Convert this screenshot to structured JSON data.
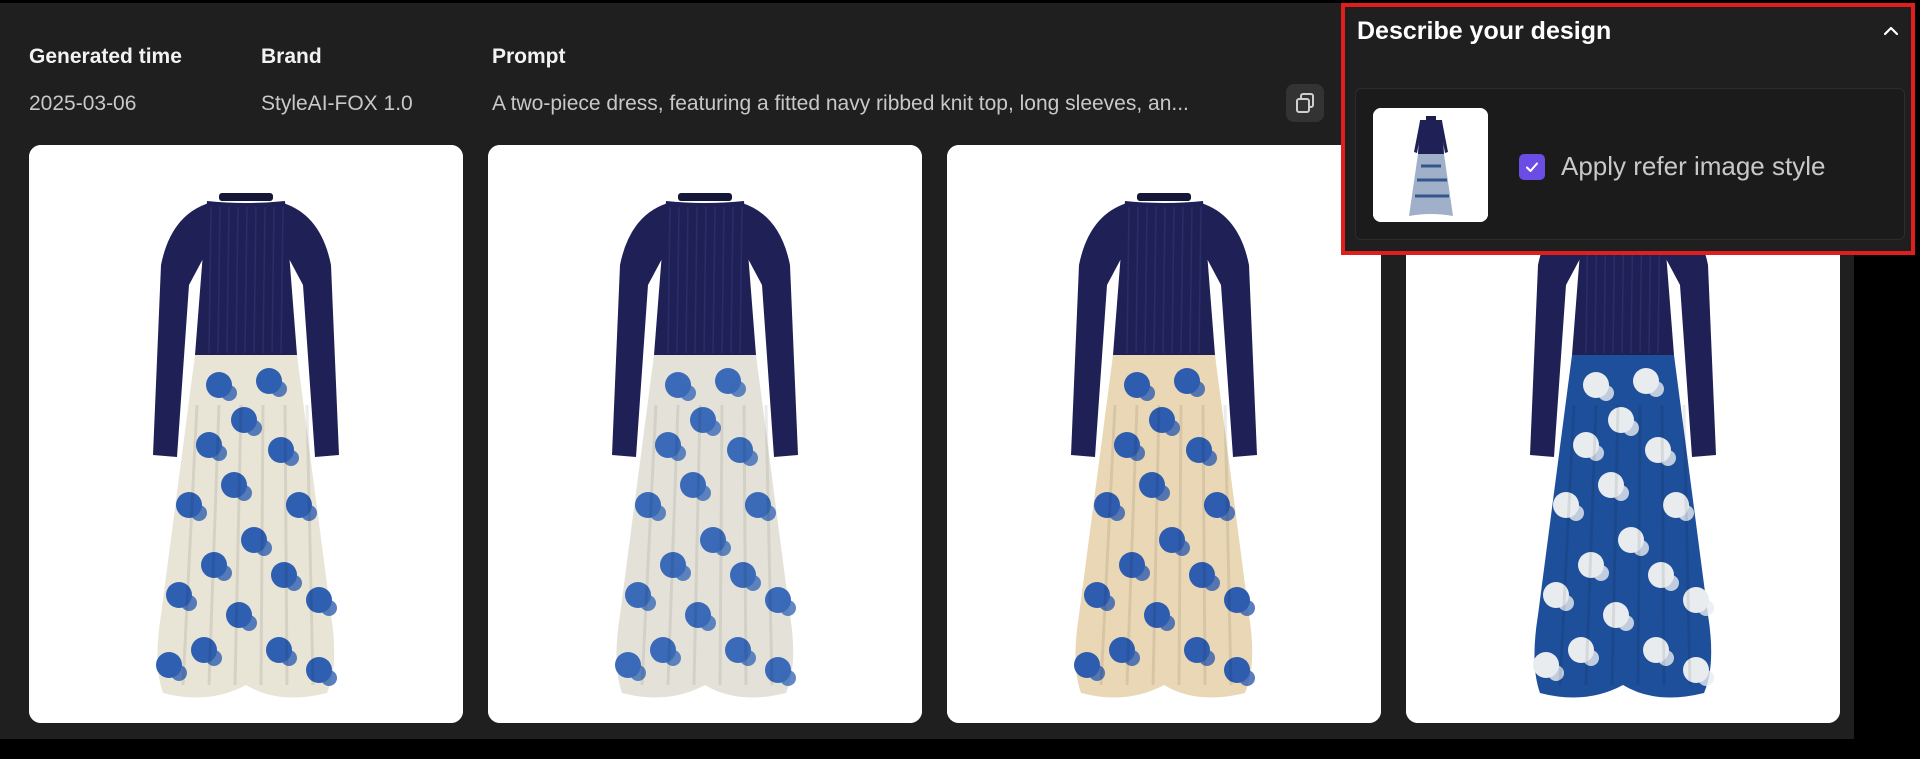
{
  "meta": {
    "generated_time": {
      "label": "Generated time",
      "value": "2025-03-06"
    },
    "brand": {
      "label": "Brand",
      "value": "StyleAI-FOX 1.0"
    },
    "prompt": {
      "label": "Prompt",
      "value": "A two-piece dress, featuring a fitted navy ribbed knit top, long sleeves, an..."
    }
  },
  "gallery": {
    "images": [
      {
        "icon": "dress-image",
        "skirt_bg": "#e8e4d6",
        "skirt_print": "#2f5fb0"
      },
      {
        "icon": "dress-image",
        "skirt_bg": "#e4e2d8",
        "skirt_print": "#3a6ab8"
      },
      {
        "icon": "dress-image",
        "skirt_bg": "#ead7b5",
        "skirt_print": "#2e5cae"
      },
      {
        "icon": "dress-image",
        "skirt_bg": "#1e4f9a",
        "skirt_print": "#e9ecef"
      }
    ]
  },
  "design_panel": {
    "title": "Describe your design",
    "checkbox_label": "Apply refer image style",
    "checkbox_checked": true
  },
  "colors": {
    "accent": "#6b4de6",
    "highlight_border": "#e01e1e",
    "background": "#1f1f1f"
  }
}
